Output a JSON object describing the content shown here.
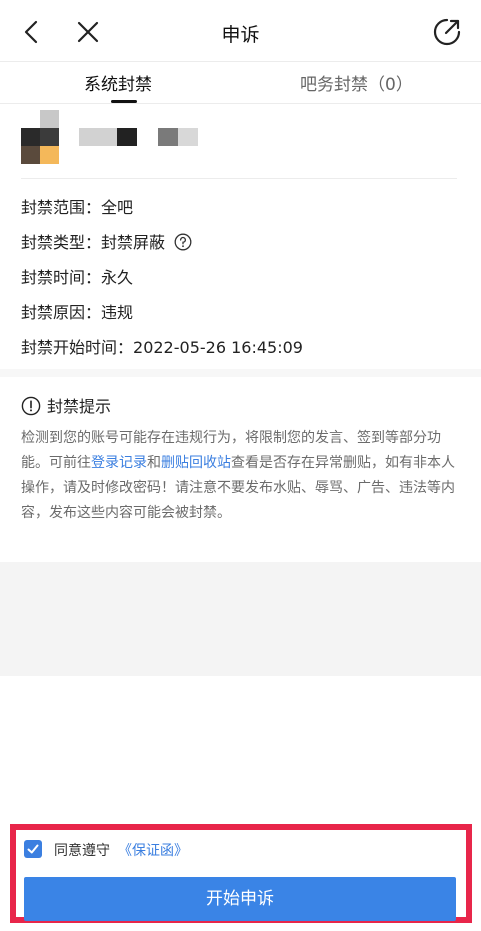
{
  "header": {
    "title": "申诉"
  },
  "tabs": [
    {
      "label": "系统封禁"
    },
    {
      "label": "吧务封禁（0）"
    }
  ],
  "ban_info": {
    "scope_label": "封禁范围：",
    "scope_value": "全吧",
    "type_label": "封禁类型：",
    "type_value": "封禁屏蔽",
    "time_label": "封禁时间：",
    "time_value": "永久",
    "reason_label": "封禁原因：",
    "reason_value": "违规",
    "start_label": "封禁开始时间：",
    "start_value": "2022-05-26 16:45:09"
  },
  "notice": {
    "title": "封禁提示",
    "text_1": "检测到您的账号可能存在违规行为，将限制您的发言、签到等部分功能。可前往",
    "link_1": "登录记录",
    "text_2": "和",
    "link_2": "删贴回收站",
    "text_3": "查看是否存在异常删贴，如有非本人操作，请及时修改密码！请注意不要发布水贴、辱骂、广告、违法等内容，发布这些内容可能会被封禁。"
  },
  "agreement": {
    "checked": true,
    "text": "同意遵守",
    "link": "《保证函》"
  },
  "submit_label": "开始申诉",
  "colors": {
    "accent": "#3a84e6",
    "link": "#3b7fe0",
    "highlight_border": "#e8264a"
  }
}
